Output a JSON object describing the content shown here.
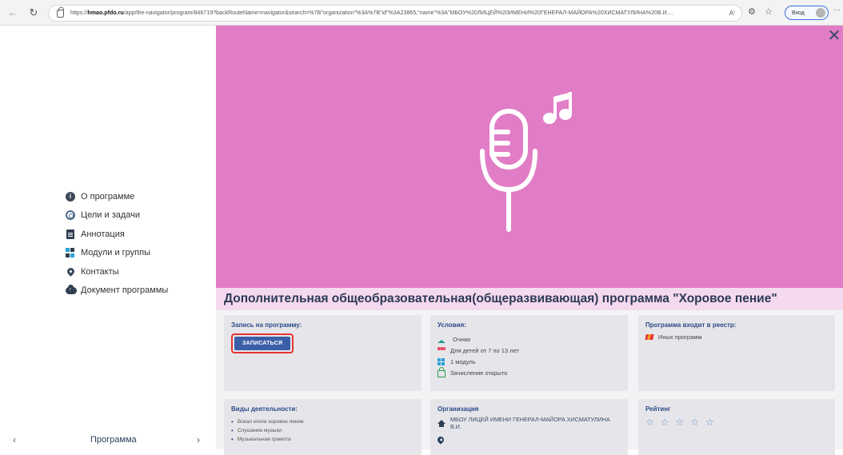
{
  "browser": {
    "url_prefix": "https://",
    "url_host": "hmao.pfdo.ru",
    "url_rest": "/app/the-navigator/program/846719?backRouteName=navigator&search=%7B\"organization\"%3A%7B\"id\"%3A23865,\"name\"%3A\"МБОУ%20ЛИЦЕЙ%20ИМЕНИ%20ГЕНЕРАЛ-МАЙОРА%20ХИСМАТУЛИНА%20В.И....",
    "reader_mode": "A⁾",
    "login_label": "Вход",
    "more": "···"
  },
  "sidebar": {
    "items": [
      {
        "label": "О программе",
        "icon": "info-icon"
      },
      {
        "label": "Цели и задачи",
        "icon": "target-icon"
      },
      {
        "label": "Аннотация",
        "icon": "document-icon"
      },
      {
        "label": "Модули и группы",
        "icon": "modules-icon"
      },
      {
        "label": "Контакты",
        "icon": "location-pin-icon"
      },
      {
        "label": "Документ программы",
        "icon": "cloud-upload-icon"
      }
    ],
    "nav_label": "Программа",
    "prev": "‹",
    "next": "›"
  },
  "main": {
    "close": "✕",
    "title": "Дополнительная общеобразовательная(общеразвивающая) программа \"Хоровое пение\"",
    "banner_color": "#e17dc6",
    "enroll": {
      "heading": "Запись на программу:",
      "button": "ЗАПИСАТЬСЯ"
    },
    "conditions": {
      "heading": "Условия:",
      "form": "Очная",
      "age": "Для детей от 7 по 13 лет",
      "modules": "1 модуль",
      "status": "Зачисление открыто"
    },
    "registry": {
      "heading": "Программа входит в реестр:",
      "value": "Иных программ"
    },
    "activities": {
      "heading": "Виды деятельности:",
      "items": [
        "Вокал и/или хоровое пение",
        "Слушание музыки",
        "Музыкальная грамота"
      ]
    },
    "organization": {
      "heading": "Организация",
      "name": "МБОУ ЛИЦЕЙ ИМЕНИ ГЕНЕРАЛ-МАЙОРА ХИСМАТУЛИНА В.И."
    },
    "rating": {
      "heading": "Рейтинг",
      "value": 0,
      "max": 5
    }
  }
}
